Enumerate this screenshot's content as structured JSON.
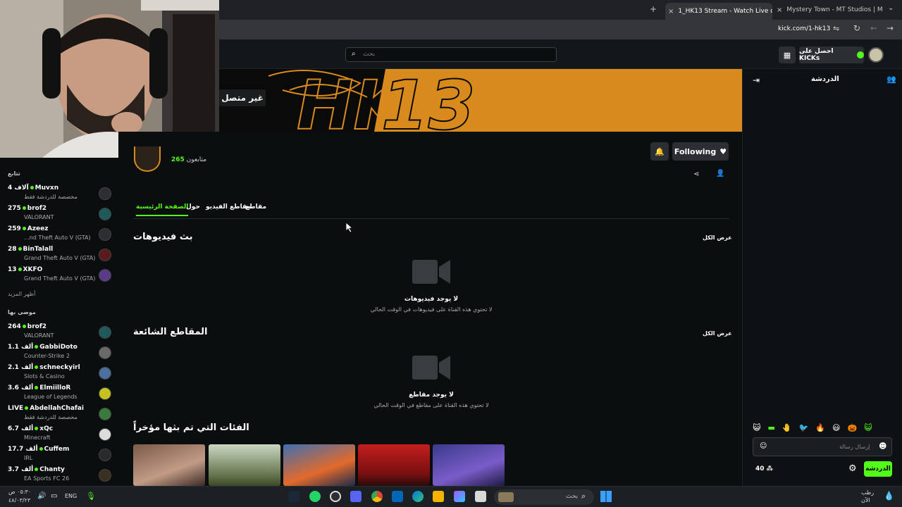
{
  "browser": {
    "tabs": [
      {
        "label": "1_HK13 Stream - Watch Live on",
        "active": true
      },
      {
        "label": "Mystery Town - MT Studios | M",
        "active": false
      }
    ],
    "url": "kick.com/1-hk13"
  },
  "header": {
    "search_placeholder": "بحث",
    "kicks_button": "احصل على KICKs"
  },
  "banner": {
    "logo_text": "HK13",
    "offline_label": "غير متصل"
  },
  "profile": {
    "followers_count": "265",
    "followers_label": "متابعون",
    "following_button": "Following"
  },
  "profile_tabs": [
    "الصفحة الرئيسية",
    "حول",
    "مقاطع الفيديو",
    "مقاطع"
  ],
  "sections": {
    "videos_title": "بث فيديوهات",
    "view_all": "عرض الكل",
    "no_videos_title": "لا يوجد فيديوهات",
    "no_videos_sub": "لا تحتوي هذه القناة على فيديوهات في الوقت الحالي",
    "clips_title": "المقاطع الشائعة",
    "no_clips_title": "لا يوجد مقاطع",
    "no_clips_sub": "لا تحتوي هذه القناة على مقاطع في الوقت الحالي",
    "categories_title": "الفئات التي تم بثها مؤخراً"
  },
  "sidebar": {
    "following_title": "تتابع",
    "following": [
      {
        "count": "4 آلاف",
        "name": "Muvxn",
        "game": "مخصصة للدردشة فقط"
      },
      {
        "count": "275",
        "name": "brof2",
        "game": "VALORANT"
      },
      {
        "count": "259",
        "name": "Azeez",
        "game": "...nd Theft Auto V (GTA)"
      },
      {
        "count": "28",
        "name": "BinTalall",
        "game": "Grand Theft Auto V (GTA)"
      },
      {
        "count": "13",
        "name": "XKFO",
        "game": "Grand Theft Auto V (GTA)"
      }
    ],
    "show_more": "أظهر المزيد",
    "recommended_title": "موصى بها",
    "recommended": [
      {
        "count": "264",
        "name": "brof2",
        "game": "VALORANT"
      },
      {
        "count": "1.1 ألف",
        "name": "GabbiDoto",
        "game": "Counter-Strike 2"
      },
      {
        "count": "2.1 ألف",
        "name": "schneckyirl",
        "game": "Slots & Casino"
      },
      {
        "count": "3.6 ألف",
        "name": "ElmiilloR",
        "game": "League of Legends"
      },
      {
        "count": "LIVE",
        "name": "AbdellahChafai",
        "game": "مخصصة للدردشة فقط"
      },
      {
        "count": "6.7 ألف",
        "name": "xQc",
        "game": "Minecraft"
      },
      {
        "count": "17.7 ألف",
        "name": "Cuffem",
        "game": "IRL"
      },
      {
        "count": "3.7 ألف",
        "name": "Chanty",
        "game": "EA Sports FC 26"
      }
    ]
  },
  "chat": {
    "title": "الدردشة",
    "input_placeholder": "إرسال رسالة",
    "kicks_count": "40",
    "send_button": "الدردشة"
  },
  "taskbar": {
    "search_placeholder": "بحث",
    "lang": "ENG",
    "time": "٠٥:٣٠ ص",
    "date": "٤٨/٠٣/٢٣",
    "weather": "رطب الآن"
  },
  "colors": {
    "accent": "#53fc18",
    "banner_orange": "#d88a1c"
  }
}
